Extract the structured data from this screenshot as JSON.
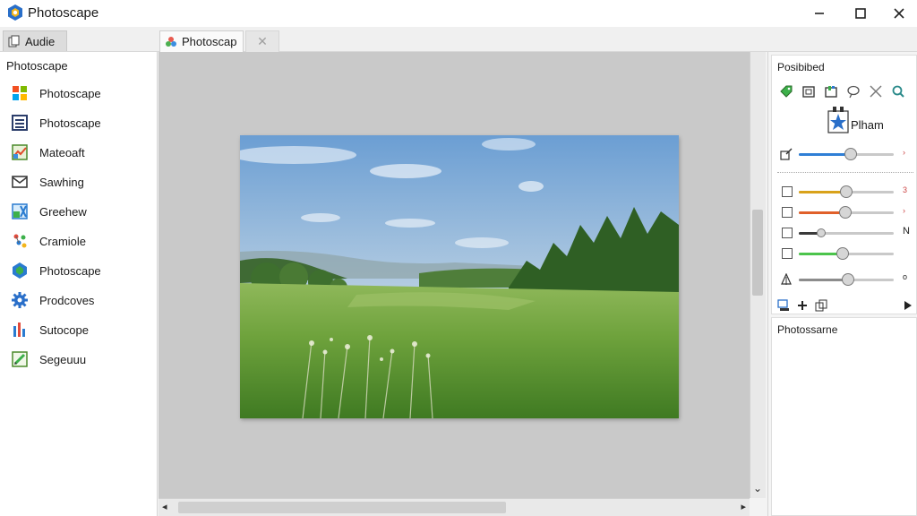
{
  "window": {
    "title": "Photoscape",
    "minimize_glyph": "—",
    "maximize_glyph": "☐",
    "close_glyph": "✕"
  },
  "tabs": {
    "left_tab_label": "Audie",
    "doc_tab_label": "Photoscap",
    "doc_tab_close_glyph": "✕"
  },
  "sidebar": {
    "header": "Photoscape",
    "items": [
      {
        "label": "Photoscape",
        "icon": "windows-tiles-icon"
      },
      {
        "label": "Photoscape",
        "icon": "list-frame-icon"
      },
      {
        "label": "Mateoaft",
        "icon": "collage-icon"
      },
      {
        "label": "Sawhing",
        "icon": "envelope-icon"
      },
      {
        "label": "Greehew",
        "icon": "combine-icon"
      },
      {
        "label": "Cramiole",
        "icon": "scatter-icon"
      },
      {
        "label": "Photoscape",
        "icon": "shape-icon"
      },
      {
        "label": "Prodcoves",
        "icon": "gear-icon"
      },
      {
        "label": "Sutocope",
        "icon": "bars-icon"
      },
      {
        "label": "Segeuuu",
        "icon": "pencil-icon"
      }
    ]
  },
  "right_panel": {
    "title": "Posibibed",
    "preset_label": "Plham",
    "sliders": [
      {
        "level": 0.55,
        "color": "#2f7fd6",
        "value": "›"
      },
      {
        "level": 0.5,
        "color": "#d9a21a",
        "value": "3"
      },
      {
        "level": 0.49,
        "color": "#e0602a",
        "value": "›"
      },
      {
        "level": 0.24,
        "color": "#3a3a3a",
        "value": "N"
      },
      {
        "level": 0.46,
        "color": "#4cc44c",
        "value": ""
      },
      {
        "level": 0.52,
        "color": "#8c8c8c",
        "value": "o"
      }
    ],
    "section2_title": "Photossarne"
  },
  "scroll": {
    "down_arrow": "⌄",
    "left_arrow": "◂",
    "right_arrow": "▸"
  }
}
